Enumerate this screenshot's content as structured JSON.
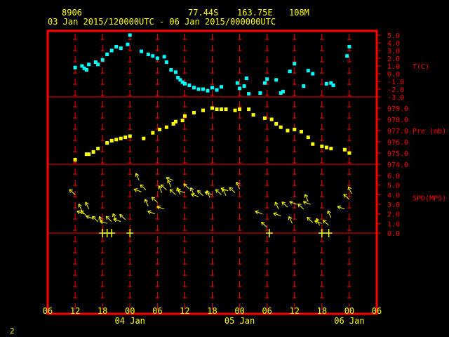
{
  "header": {
    "station_id": "8906",
    "lat": "77.44S",
    "lon": "163.75E",
    "elevation": "108M",
    "time_range": "03 Jan 2015/120000UTC - 06 Jan 2015/000000UTC"
  },
  "page_number": "2",
  "colors": {
    "frame": "#ff0000",
    "text": "#ffff00",
    "temperature": "#00ffff",
    "pressure": "#ffff00",
    "wind": "#ffff00",
    "axis_labels": "#ff0000"
  },
  "chart_data": [
    {
      "type": "scatter",
      "name": "temperature",
      "ylabel": "T(C)",
      "ylim": [
        -3.0,
        5.0
      ],
      "yticks": [
        "5.0",
        "4.0",
        "3.0",
        "2.0",
        "1.0",
        "0.0",
        "-1.0",
        "-2.0",
        "-3.0"
      ],
      "x_hours": [
        12.0,
        13.5,
        14.0,
        14.5,
        15.0,
        16.5,
        17.0,
        18.0,
        19.0,
        20.0,
        21.0,
        22.0,
        23.5,
        24.0,
        26.5,
        28.0,
        29.0,
        30.0,
        31.5,
        32.0,
        33.0,
        34.0,
        34.5,
        35.0,
        35.5,
        36.0,
        37.0,
        38.0,
        39.0,
        40.0,
        41.0,
        42.0,
        43.0,
        44.0,
        47.5,
        48.0,
        49.0,
        49.5,
        50.0,
        52.5,
        53.5,
        54.0,
        56.0,
        57.0,
        57.5,
        59.0,
        60.0,
        62.0,
        63.0,
        64.0,
        67.0,
        68.0,
        68.5,
        71.5,
        72.0
      ],
      "values": [
        0.8,
        1.0,
        0.7,
        0.5,
        1.2,
        1.5,
        1.2,
        1.8,
        2.5,
        3.0,
        3.5,
        3.3,
        3.8,
        5.0,
        2.9,
        2.5,
        2.3,
        2.0,
        2.2,
        1.5,
        0.5,
        0.2,
        -0.5,
        -0.8,
        -1.1,
        -1.3,
        -1.5,
        -1.8,
        -2.0,
        -2.0,
        -2.2,
        -1.8,
        -2.1,
        -1.7,
        -1.2,
        -1.9,
        -1.6,
        -0.6,
        -2.6,
        -2.5,
        -1.2,
        -0.7,
        -0.8,
        -2.5,
        -2.3,
        0.3,
        1.3,
        -1.6,
        0.4,
        0.0,
        -1.3,
        -1.2,
        -1.5,
        2.3,
        3.5
      ]
    },
    {
      "type": "scatter",
      "name": "pressure",
      "ylabel": "Pre (mb)",
      "ylim": [
        974.0,
        979.0
      ],
      "yticks": [
        "979.0",
        "978.0",
        "977.0",
        "976.0",
        "975.0",
        "974.0"
      ],
      "x_hours": [
        12.0,
        14.5,
        15.0,
        16.0,
        17.0,
        19.0,
        20.0,
        21.0,
        22.0,
        23.0,
        24.0,
        27.0,
        29.0,
        30.5,
        32.0,
        33.5,
        34.0,
        35.5,
        36.0,
        38.0,
        40.0,
        42.0,
        43.0,
        44.0,
        45.0,
        47.0,
        48.0,
        50.0,
        51.0,
        53.5,
        55.0,
        56.0,
        57.0,
        58.5,
        60.0,
        61.5,
        63.0,
        64.0,
        66.0,
        67.0,
        68.0,
        71.0,
        72.0
      ],
      "values": [
        974.4,
        974.9,
        974.9,
        975.1,
        975.4,
        975.9,
        976.1,
        976.2,
        976.3,
        976.4,
        976.5,
        976.3,
        976.8,
        977.1,
        977.3,
        977.6,
        977.8,
        977.9,
        978.3,
        978.6,
        978.8,
        979.0,
        978.9,
        978.9,
        978.9,
        978.8,
        978.9,
        978.9,
        978.4,
        978.1,
        978.0,
        977.6,
        977.3,
        977.0,
        977.1,
        976.9,
        976.4,
        975.8,
        975.6,
        975.5,
        975.4,
        975.3,
        975.0,
        974.3
      ]
    },
    {
      "type": "scatter",
      "name": "wind",
      "ylabel": "SPD(MPS)",
      "ylim": [
        0.0,
        6.0
      ],
      "yticks": [
        "6.0",
        "5.0",
        "4.0",
        "3.0",
        "2.0",
        "1.0",
        "0.0"
      ],
      "barb_x_hours": [
        18.0,
        19.0,
        20.0,
        24.0,
        54.5,
        66.0,
        67.5
      ],
      "x_hours": [
        12.0,
        13.5,
        14.0,
        14.5,
        15.0,
        16.0,
        17.0,
        18.0,
        19.0,
        20.0,
        21.0,
        22.0,
        23.0,
        26.0,
        26.5,
        27.5,
        28.0,
        29.5,
        30.0,
        31.0,
        31.5,
        32.0,
        33.0,
        33.5,
        34.0,
        35.0,
        36.0,
        37.0,
        38.0,
        39.0,
        40.0,
        41.5,
        42.0,
        44.0,
        45.0,
        45.5,
        47.0,
        48.0,
        53.0,
        54.0,
        56.5,
        57.0,
        58.5,
        59.5,
        60.5,
        62.0,
        63.0,
        63.5,
        64.0,
        65.5,
        66.0,
        67.5,
        68.0,
        71.0,
        72.0,
        72.5
      ],
      "values": [
        4.0,
        2.3,
        2.0,
        1.8,
        2.5,
        1.5,
        1.2,
        1.0,
        1.0,
        1.2,
        1.3,
        1.2,
        1.4,
        5.5,
        4.3,
        4.5,
        2.8,
        2.0,
        3.2,
        4.2,
        2.5,
        4.5,
        4.8,
        5.5,
        4.0,
        4.0,
        4.2,
        4.6,
        4.0,
        3.8,
        3.9,
        3.7,
        4.0,
        4.0,
        3.9,
        4.4,
        4.2,
        4.6,
        2.0,
        0.6,
        2.5,
        1.8,
        2.7,
        1.0,
        3.0,
        2.5,
        3.3,
        3.0,
        1.1,
        0.8,
        1.0,
        0.8,
        1.6,
        2.5,
        3.5,
        4.1
      ]
    }
  ],
  "x_axis": {
    "range_hours": [
      6,
      78
    ],
    "ticks": [
      "06",
      "12",
      "18",
      "00",
      "06",
      "12",
      "18",
      "00",
      "06",
      "12",
      "18",
      "00",
      "06"
    ],
    "day_labels": [
      "04 Jan",
      "05 Jan",
      "06 Jan"
    ]
  }
}
